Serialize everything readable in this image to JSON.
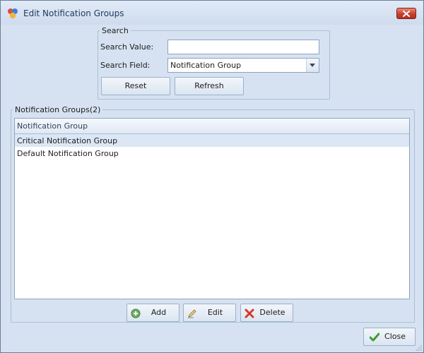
{
  "window": {
    "title": "Edit Notification Groups"
  },
  "search": {
    "legend": "Search",
    "value_label": "Search Value:",
    "value": "",
    "field_label": "Search Field:",
    "field_selected": "Notification Group",
    "reset_label": "Reset",
    "refresh_label": "Refresh"
  },
  "groups": {
    "legend": "Notification Groups(2)",
    "column_header": "Notification Group",
    "rows": [
      {
        "name": "Critical Notification Group"
      },
      {
        "name": "Default Notification Group"
      }
    ],
    "add_label": "Add",
    "edit_label": "Edit",
    "delete_label": "Delete"
  },
  "footer": {
    "close_label": "Close"
  },
  "colors": {
    "title_text": "#1e395b",
    "window_bg": "#d6e2f1",
    "selected_row": "#dce7f5",
    "close_red": "#c8402e"
  },
  "icons": {
    "app": "notification-groups-icon",
    "add": "add-icon",
    "edit": "pencil-icon",
    "delete": "delete-x-icon",
    "close": "checkmark-icon"
  }
}
